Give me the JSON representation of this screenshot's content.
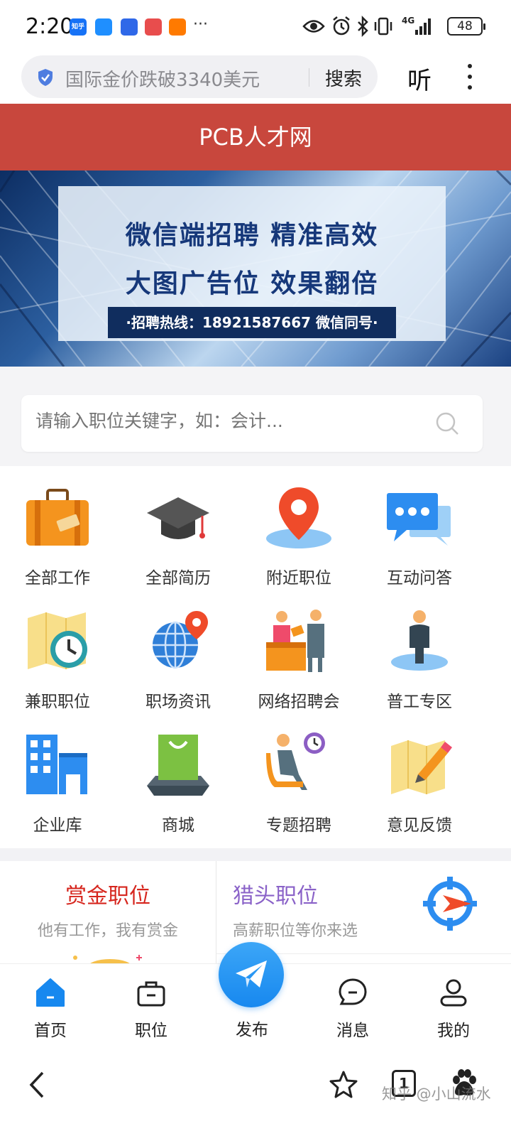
{
  "status_bar": {
    "time": "2:20",
    "app_icons": [
      {
        "name": "zhihu-icon",
        "label": "知乎",
        "color": "#1772f6"
      },
      {
        "name": "chat-app-icon",
        "label": "",
        "color": "#1f8fff"
      },
      {
        "name": "baidu-app-icon",
        "label": "",
        "color": "#2f68e8"
      },
      {
        "name": "shop-app-icon",
        "label": "",
        "color": "#e84d4d"
      },
      {
        "name": "taobao-app-icon",
        "label": "",
        "color": "#ff7a00"
      }
    ],
    "more": "···",
    "network": "4G",
    "battery": "48"
  },
  "browser": {
    "url_text": "国际金价跌破3340美元",
    "search_label": "搜索",
    "listen_label": "听"
  },
  "header": {
    "title": "PCB人才网",
    "color": "#c8473d"
  },
  "banner": {
    "line1": "微信端招聘  精准高效",
    "line2": "大图广告位  效果翻倍",
    "hotline": "·招聘热线：18921587667 微信同号·"
  },
  "search": {
    "placeholder": "请输入职位关键字，如：会计..."
  },
  "grid": {
    "items": [
      {
        "label": "全部工作",
        "icon": "briefcase-icon"
      },
      {
        "label": "全部简历",
        "icon": "graduation-cap-icon"
      },
      {
        "label": "附近职位",
        "icon": "location-pin-icon"
      },
      {
        "label": "互动问答",
        "icon": "chat-bubbles-icon"
      },
      {
        "label": "兼职职位",
        "icon": "map-clock-icon"
      },
      {
        "label": "职场资讯",
        "icon": "globe-pin-icon"
      },
      {
        "label": "网络招聘会",
        "icon": "interview-desk-icon"
      },
      {
        "label": "普工专区",
        "icon": "worker-icon"
      },
      {
        "label": "企业库",
        "icon": "building-icon"
      },
      {
        "label": "商城",
        "icon": "shopping-bag-icon"
      },
      {
        "label": "专题招聘",
        "icon": "waiting-chair-icon"
      },
      {
        "label": "意见反馈",
        "icon": "map-pencil-icon"
      }
    ]
  },
  "promo": {
    "left_title": "赏金职位",
    "left_sub": "他有工作，我有赏金",
    "right_title": "猎头职位",
    "right_sub": "高薪职位等你来选"
  },
  "bottom_nav": {
    "items": [
      {
        "label": "首页",
        "icon": "home-icon"
      },
      {
        "label": "职位",
        "icon": "briefcase-outline-icon"
      },
      {
        "label": "发布",
        "icon": "paper-plane-icon"
      },
      {
        "label": "消息",
        "icon": "message-icon"
      },
      {
        "label": "我的",
        "icon": "user-icon"
      }
    ],
    "active_color": "#1788ef"
  },
  "system_bar": {
    "tab_count": "1"
  },
  "watermark": "知乎 @小山流水"
}
